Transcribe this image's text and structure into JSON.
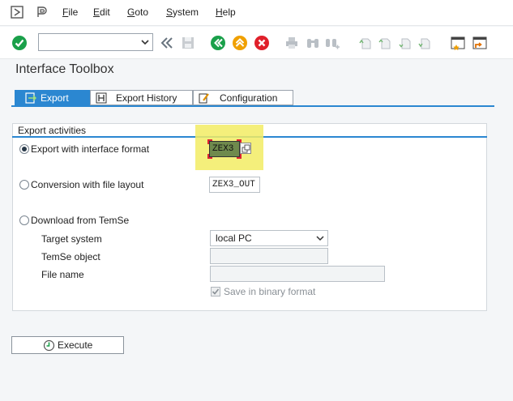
{
  "menu": {
    "items": [
      {
        "label": "File",
        "underline": "F",
        "rest": "ile"
      },
      {
        "label": "Edit",
        "underline": "E",
        "rest": "dit"
      },
      {
        "label": "Goto",
        "underline": "G",
        "rest": "oto"
      },
      {
        "label": "System",
        "underline": "S",
        "rest": "ystem"
      },
      {
        "label": "Help",
        "underline": "H",
        "rest": "elp"
      }
    ]
  },
  "toolbar": {
    "command_field_value": ""
  },
  "page": {
    "title": "Interface Toolbox"
  },
  "tabs": [
    {
      "label": "Export",
      "active": true
    },
    {
      "label": "Export History",
      "active": false
    },
    {
      "label": "Configuration",
      "active": false
    }
  ],
  "group": {
    "title": "Export activities",
    "options": [
      {
        "label": "Export with interface format",
        "selected": true,
        "value": "ZEX3"
      },
      {
        "label": "Conversion with file layout",
        "selected": false,
        "value": "ZEX3_OUT"
      },
      {
        "label": "Download from TemSe",
        "selected": false
      }
    ],
    "target_system": {
      "label": "Target system",
      "value": "local PC"
    },
    "temse_object": {
      "label": "TemSe object",
      "value": ""
    },
    "file_name": {
      "label": "File name",
      "value": ""
    },
    "binary": {
      "label": "Save in binary format",
      "checked": true
    }
  },
  "execute": {
    "label": "Execute"
  },
  "colors": {
    "accent": "#2b87d1",
    "highlight": "#f2ec64",
    "ok": "#1aa04a",
    "cancel": "#e0202a",
    "exit": "#f0a000"
  }
}
